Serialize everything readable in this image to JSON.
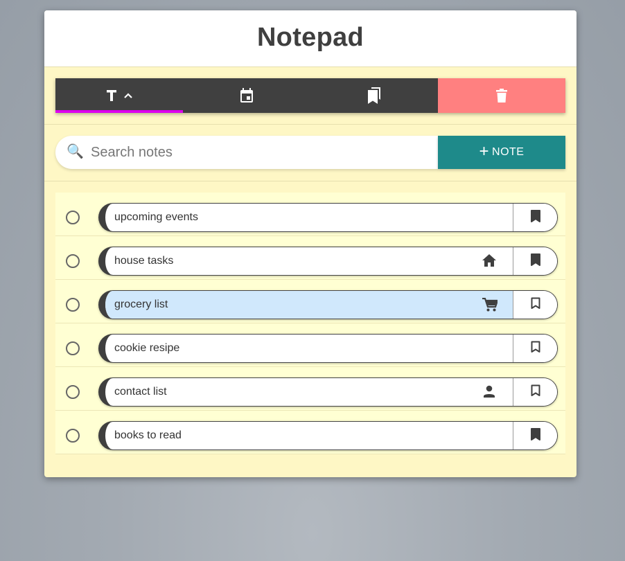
{
  "app": {
    "title": "Notepad"
  },
  "toolbar": {
    "buttons": [
      {
        "name": "sort-text",
        "icons": [
          "text-icon",
          "chevron-up-icon"
        ],
        "active": true
      },
      {
        "name": "sort-date",
        "icons": [
          "calendar-icon"
        ],
        "active": false
      },
      {
        "name": "bookmarks",
        "icons": [
          "bookmarks-icon"
        ],
        "active": false
      },
      {
        "name": "delete",
        "icons": [
          "trash-icon"
        ],
        "active": false
      }
    ],
    "colors": {
      "bar": "#404040",
      "active_indicator": "#dd00ee",
      "delete": "#ff8080"
    }
  },
  "search": {
    "placeholder": "Search notes",
    "value": "",
    "icon": "search-icon"
  },
  "add_button": {
    "plus": "+",
    "label": "NOTE",
    "color": "#1e8a8a"
  },
  "notes": [
    {
      "label": "upcoming events",
      "category_icon": "",
      "bookmarked": true,
      "selected": false
    },
    {
      "label": "house tasks",
      "category_icon": "home-icon",
      "bookmarked": true,
      "selected": false
    },
    {
      "label": "grocery list",
      "category_icon": "cart-icon",
      "bookmarked": false,
      "selected": true
    },
    {
      "label": "cookie resipe",
      "category_icon": "",
      "bookmarked": false,
      "selected": false
    },
    {
      "label": "contact list",
      "category_icon": "person-icon",
      "bookmarked": false,
      "selected": false
    },
    {
      "label": "books to read",
      "category_icon": "",
      "bookmarked": true,
      "selected": false
    }
  ]
}
